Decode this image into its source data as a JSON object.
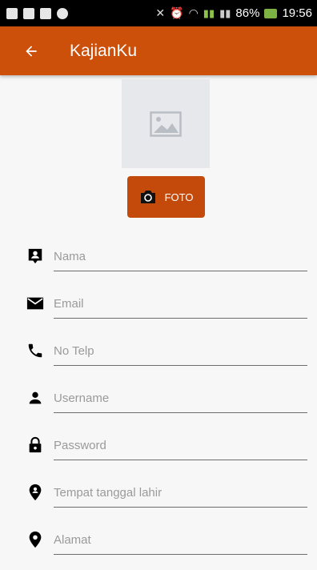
{
  "status_bar": {
    "battery": "86%",
    "time": "19:56"
  },
  "app_bar": {
    "title": "KajianKu"
  },
  "photo": {
    "button_label": "FOTO"
  },
  "form": {
    "fields": [
      {
        "placeholder": "Nama",
        "icon": "contact-icon"
      },
      {
        "placeholder": "Email",
        "icon": "email-icon"
      },
      {
        "placeholder": "No Telp",
        "icon": "phone-icon"
      },
      {
        "placeholder": "Username",
        "icon": "person-icon"
      },
      {
        "placeholder": "Password",
        "icon": "lock-icon"
      },
      {
        "placeholder": "Tempat tanggal lahir",
        "icon": "place-icon"
      },
      {
        "placeholder": "Alamat",
        "icon": "location-icon"
      }
    ]
  },
  "colors": {
    "app_bar": "#cc4f0a",
    "button": "#c44a0c"
  }
}
